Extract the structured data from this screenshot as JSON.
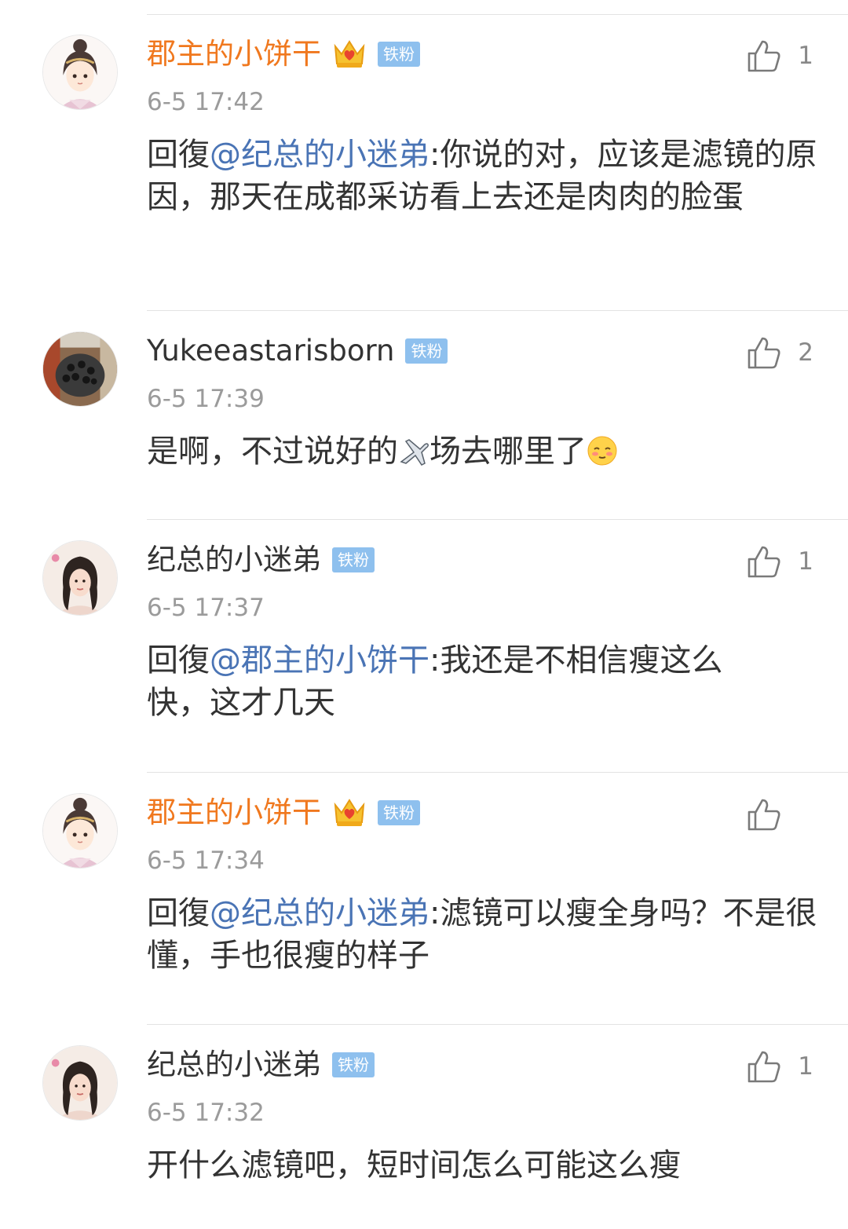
{
  "comments": [
    {
      "username": "郡主的小饼干",
      "vip": true,
      "crown_icon": "crown-heart-icon",
      "badge": "铁粉",
      "time": "6-5 17:42",
      "likes": "1",
      "reply_prefix": "回復",
      "mention": "@纪总的小迷弟",
      "text": ":你说的对，应该是滤镜的原因，那天在成都采访看上去还是肉肉的脸蛋"
    },
    {
      "username": "Yukeeastarisborn",
      "vip": false,
      "badge": "铁粉",
      "time": "6-5 17:39",
      "likes": "2",
      "text_a": "是啊，不过说好的",
      "plane_icon": "airplane-icon",
      "text_b": "场去哪里了",
      "emoji_icon": "shy-face-emoji-icon"
    },
    {
      "username": "纪总的小迷弟",
      "vip": false,
      "badge": "铁粉",
      "time": "6-5 17:37",
      "likes": "1",
      "reply_prefix": "回復",
      "mention": "@郡主的小饼干",
      "text": ":我还是不相信瘦这么快，这才几天"
    },
    {
      "username": "郡主的小饼干",
      "vip": true,
      "crown_icon": "crown-heart-icon",
      "badge": "铁粉",
      "time": "6-5 17:34",
      "likes": "",
      "reply_prefix": "回復",
      "mention": "@纪总的小迷弟",
      "text": ":滤镜可以瘦全身吗？不是很懂，手也很瘦的样子"
    },
    {
      "username": "纪总的小迷弟",
      "vip": false,
      "badge": "铁粉",
      "time": "6-5 17:32",
      "likes": "1",
      "text": "开什么滤镜吧，短时间怎么可能这么瘦"
    }
  ],
  "colors": {
    "vip_name": "#f0781e",
    "mention": "#4a74b5",
    "badge": "#8ec0ee",
    "timestamp": "#9b9b9b"
  }
}
